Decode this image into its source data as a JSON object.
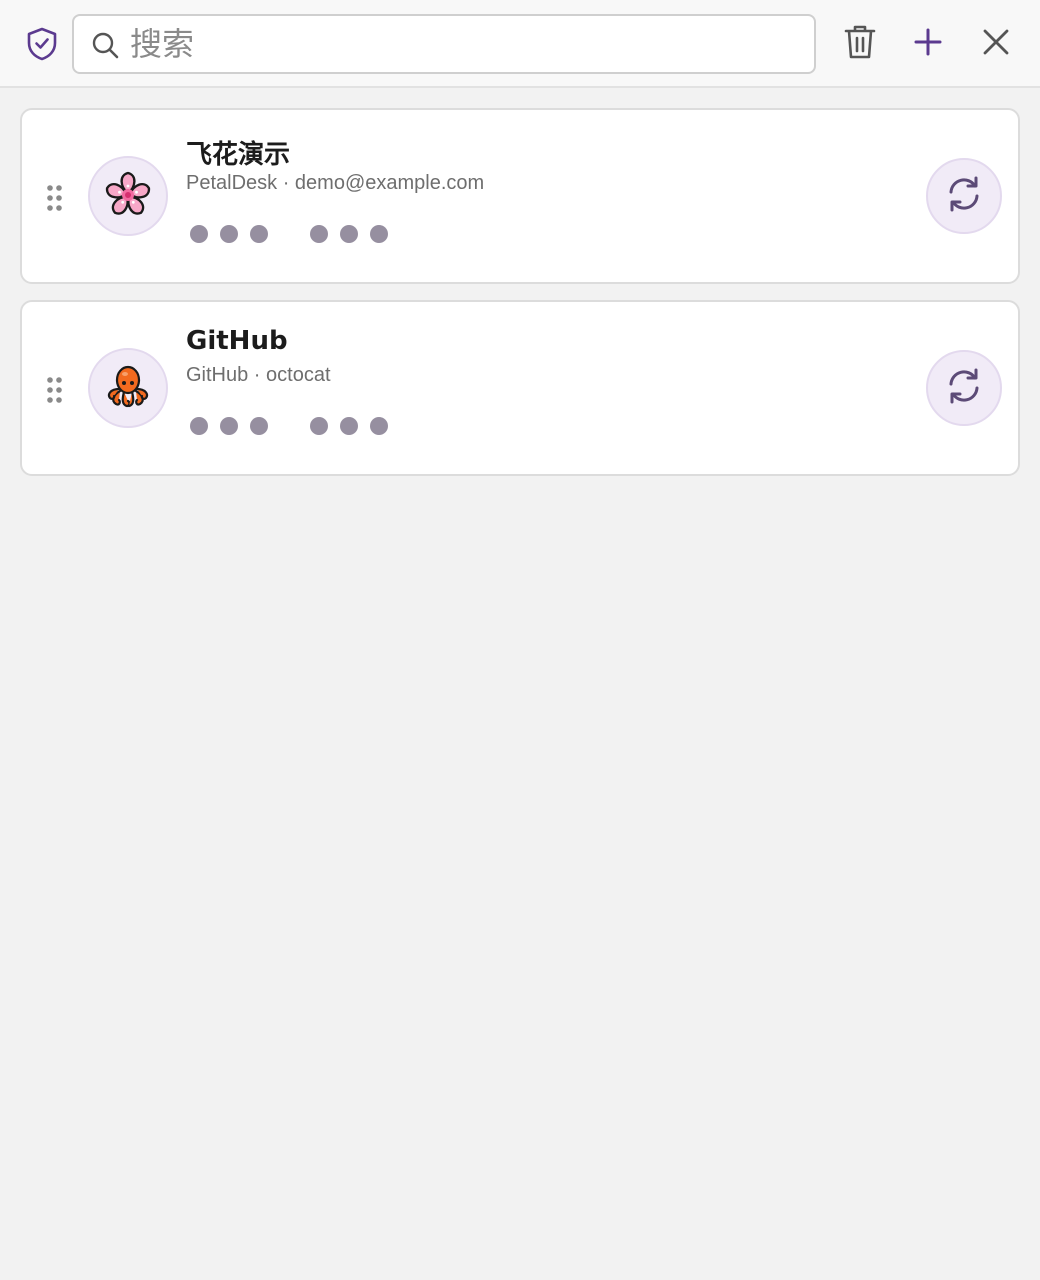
{
  "colors": {
    "accent": "#5b3a8f",
    "icon_gray": "#555555",
    "dot": "#968fa0",
    "avatar_bg": "#f1ebf7"
  },
  "toolbar": {
    "shield_icon": "shield-check-icon",
    "search": {
      "placeholder": "搜索",
      "value": "",
      "icon": "search-icon"
    },
    "buttons": [
      {
        "name": "delete",
        "icon": "trash-icon"
      },
      {
        "name": "add",
        "icon": "plus-icon"
      },
      {
        "name": "close",
        "icon": "close-icon"
      }
    ]
  },
  "accounts": [
    {
      "title": "飞花演示",
      "subtitle": "PetalDesk · demo@example.com",
      "avatar_icon": "cherry-blossom-icon",
      "code_masked": "••• •••",
      "refresh_icon": "refresh-icon"
    },
    {
      "title": "GitHub",
      "subtitle": "GitHub · octocat",
      "avatar_icon": "octopus-icon",
      "code_masked": "••• •••",
      "refresh_icon": "refresh-icon"
    }
  ]
}
